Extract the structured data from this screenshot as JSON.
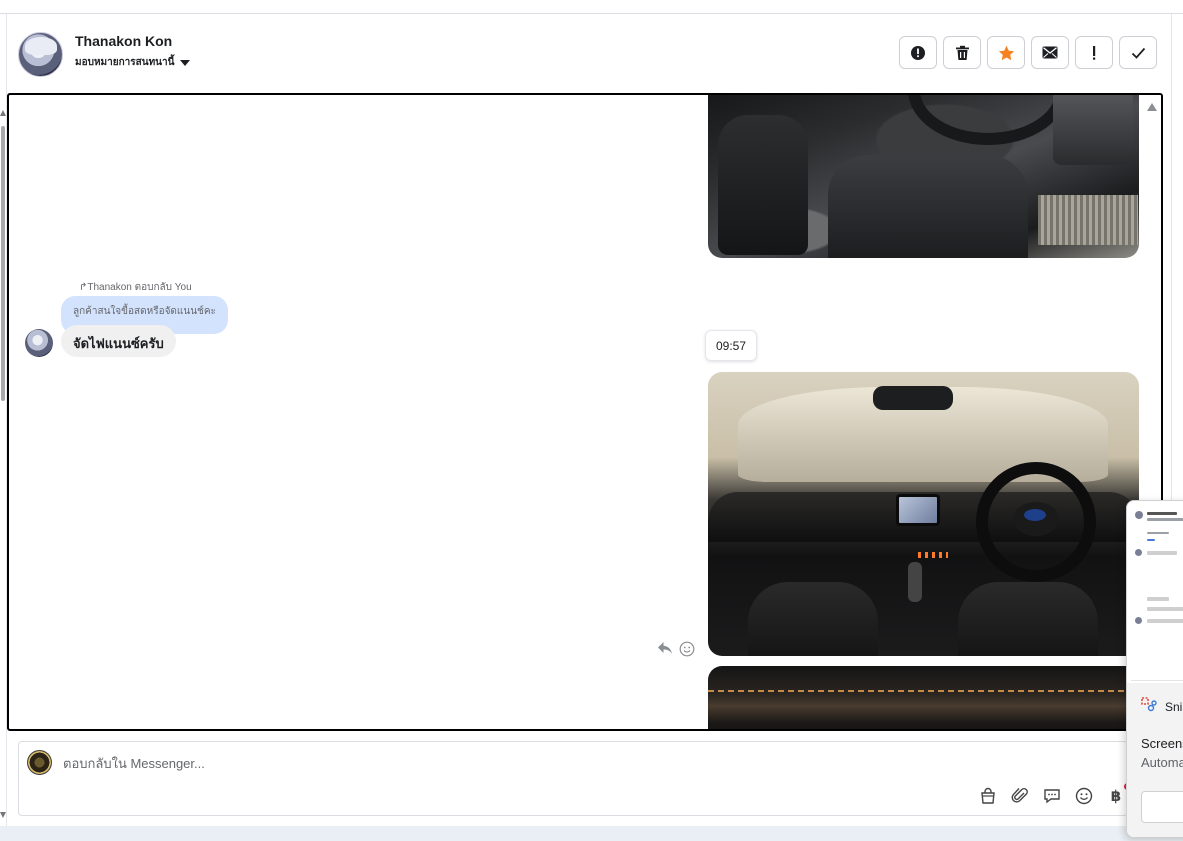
{
  "header": {
    "user_name": "Thanakon Kon",
    "assign_label": "มอบหมายการสนทนานี้",
    "actions": [
      {
        "name": "spam-button",
        "icon": "alert-circle-icon"
      },
      {
        "name": "delete-button",
        "icon": "trash-icon"
      },
      {
        "name": "star-button",
        "icon": "star-icon",
        "color": "#f5821f"
      },
      {
        "name": "mark-unread-button",
        "icon": "envelope-icon"
      },
      {
        "name": "follow-up-button",
        "icon": "exclamation-icon"
      },
      {
        "name": "done-button",
        "icon": "check-icon"
      }
    ]
  },
  "conversation": {
    "reply_meta": "↱Thanakon ตอบกลับ You",
    "quoted_text": "ลูกค้าสนใจขื้อสดหรือจัดแนนช์คะ",
    "message_text": "จัดไฟแนนซ์ครับ",
    "timestamp": "09:57"
  },
  "composer": {
    "placeholder": "ตอบกลับใน Messenger...",
    "tools": [
      "shopping-bag-icon",
      "paperclip-icon",
      "chat-bubble-icon",
      "emoji-icon",
      "baht-icon"
    ],
    "baht_symbol": "฿"
  },
  "snip_notification": {
    "app_name": "Snipping Tool",
    "title": "Screenshot copied to clipboard",
    "subtitle": "Automatically saved to screenshots folder"
  },
  "colors": {
    "accent": "#f5821f",
    "quoted_bg": "#d3e3fd",
    "bubble_bg": "#f0f0f0",
    "notification_dot": "#e41e3f"
  }
}
